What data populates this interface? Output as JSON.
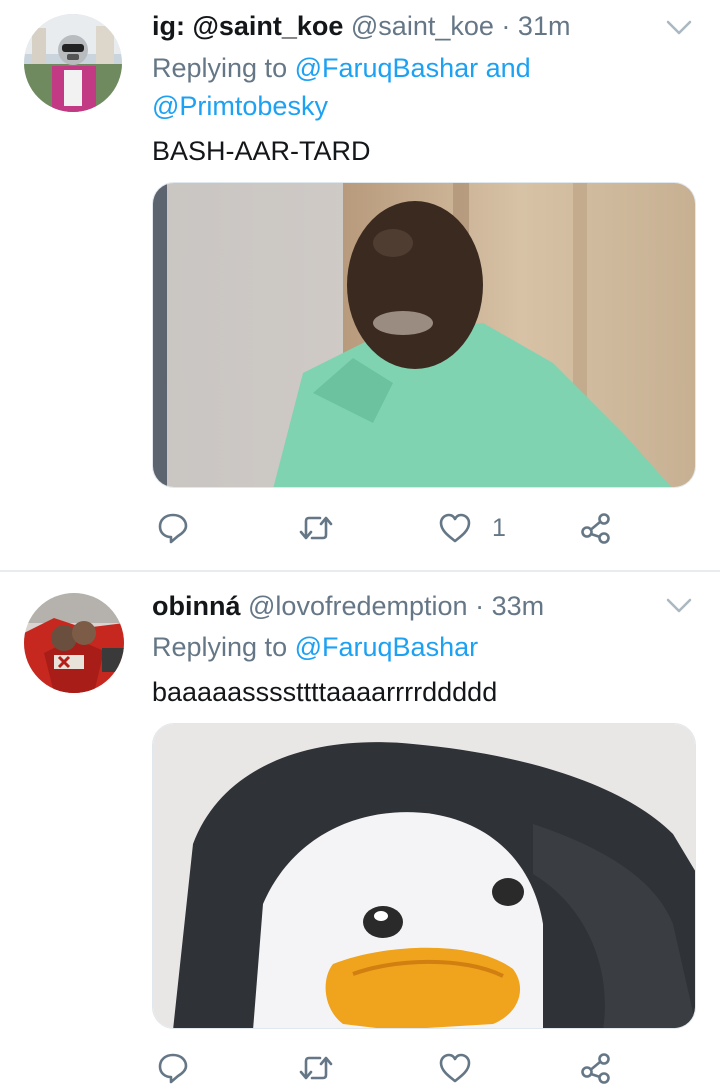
{
  "tweets": [
    {
      "display_name": "ig: @saint_koe",
      "handle": "@saint_koe",
      "separator": "·",
      "time": "31m",
      "replying_prefix": "Replying to",
      "replying_line1_mention": "@FaruqBashar",
      "replying_line1_suffix": "and",
      "replying_line2": "@Primtobesky",
      "text": "BASH-AAR-TARD",
      "reply_count": "",
      "retweet_count": "",
      "like_count": "1",
      "media": "photo of a person wearing a ski mask in mint-green clothes"
    },
    {
      "display_name": "obinná",
      "handle": "@lovofredemption",
      "separator": "·",
      "time": "33m",
      "replying_prefix": "Replying to",
      "replying_line1_mention": "@FaruqBashar",
      "text": "baaaaassssttttaaaarrrrddddd",
      "like_count": "",
      "media": "blurry photo of a cartoon penguin face"
    }
  ],
  "colors": {
    "link": "#1da1f2",
    "secondary_text": "#657786",
    "primary_text": "#14171a",
    "divider": "#e6ecf0"
  },
  "icons": [
    "chevron-down-icon",
    "reply-icon",
    "retweet-icon",
    "heart-icon",
    "share-icon"
  ]
}
